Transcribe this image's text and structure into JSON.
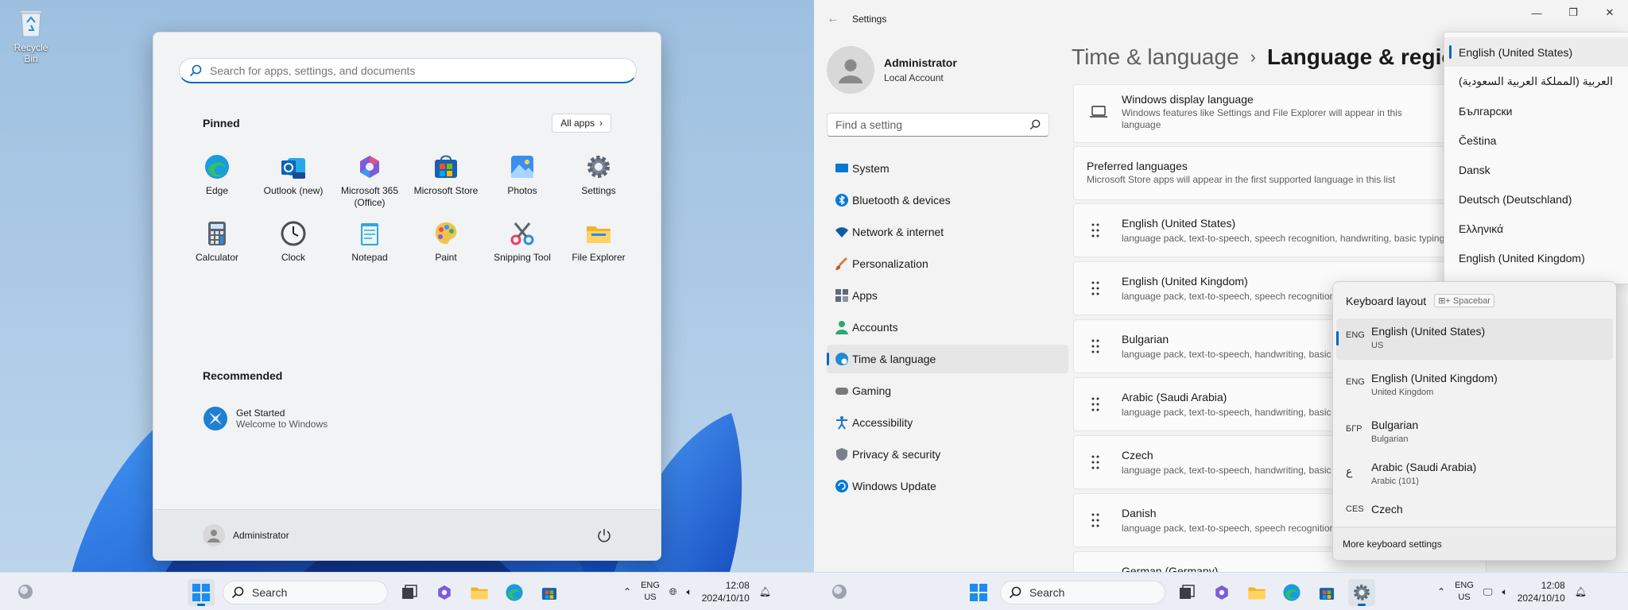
{
  "desktop": {
    "recycle_bin": "Recycle Bin"
  },
  "start": {
    "search_placeholder": "Search for apps, settings, and documents",
    "pinned_title": "Pinned",
    "all_apps": "All apps",
    "pinned": [
      {
        "label": "Edge",
        "icon": "edge-icon"
      },
      {
        "label": "Outlook (new)",
        "icon": "outlook-icon"
      },
      {
        "label": "Microsoft 365 (Office)",
        "icon": "office-icon"
      },
      {
        "label": "Microsoft Store",
        "icon": "store-icon"
      },
      {
        "label": "Photos",
        "icon": "photos-icon"
      },
      {
        "label": "Settings",
        "icon": "gear-icon"
      },
      {
        "label": "Calculator",
        "icon": "calculator-icon"
      },
      {
        "label": "Clock",
        "icon": "clock-icon"
      },
      {
        "label": "Notepad",
        "icon": "notepad-icon"
      },
      {
        "label": "Paint",
        "icon": "paint-icon"
      },
      {
        "label": "Snipping Tool",
        "icon": "snipping-icon"
      },
      {
        "label": "File Explorer",
        "icon": "folder-icon"
      }
    ],
    "recommended_title": "Recommended",
    "recommended": {
      "title": "Get Started",
      "subtitle": "Welcome to Windows"
    },
    "user": "Administrator"
  },
  "settings": {
    "title": "Settings",
    "profile": {
      "name": "Administrator",
      "account": "Local Account"
    },
    "search_placeholder": "Find a setting",
    "nav": [
      {
        "label": "System",
        "icon": "monitor-icon",
        "color": "#0078d4"
      },
      {
        "label": "Bluetooth & devices",
        "icon": "bluetooth-icon",
        "color": "#0078d4"
      },
      {
        "label": "Network & internet",
        "icon": "wifi-icon",
        "color": "#0a5ea8"
      },
      {
        "label": "Personalization",
        "icon": "brush-icon",
        "color": "#e07b39"
      },
      {
        "label": "Apps",
        "icon": "apps-icon",
        "color": "#5f6b7a"
      },
      {
        "label": "Accounts",
        "icon": "person-icon",
        "color": "#2aa876"
      },
      {
        "label": "Time & language",
        "icon": "globe-clock-icon",
        "color": "#1f8ad8"
      },
      {
        "label": "Gaming",
        "icon": "gamepad-icon",
        "color": "#7a7a7a"
      },
      {
        "label": "Accessibility",
        "icon": "accessibility-icon",
        "color": "#1d6fc9"
      },
      {
        "label": "Privacy & security",
        "icon": "shield-icon",
        "color": "#7a7f88"
      },
      {
        "label": "Windows Update",
        "icon": "update-icon",
        "color": "#0078d4"
      }
    ],
    "breadcrumb": {
      "parent": "Time & language",
      "current": "Language & regio"
    },
    "display_language": {
      "title": "Windows display language",
      "desc": "Windows features like Settings and File Explorer will appear in this language"
    },
    "preferred": {
      "title": "Preferred languages",
      "desc": "Microsoft Store apps will appear in the first supported language in this list"
    },
    "languages": [
      {
        "name": "English (United States)",
        "features": "language pack, text-to-speech, speech recognition, handwriting, basic typing"
      },
      {
        "name": "English (United Kingdom)",
        "features": "language pack, text-to-speech, speech recognition, handwriting"
      },
      {
        "name": "Bulgarian",
        "features": "language pack, text-to-speech, handwriting, basic typing"
      },
      {
        "name": "Arabic (Saudi Arabia)",
        "features": "language pack, text-to-speech, handwriting, basic typing"
      },
      {
        "name": "Czech",
        "features": "language pack, text-to-speech, handwriting, basic typing"
      },
      {
        "name": "Danish",
        "features": "language pack, text-to-speech, speech recognition"
      },
      {
        "name": "German (Germany)",
        "features": ""
      }
    ],
    "display_language_options": [
      "English (United States)",
      "العربية (المملكة العربية السعودية)",
      "Български",
      "Čeština",
      "Dansk",
      "Deutsch (Deutschland)",
      "Ελληνικά",
      "English (United Kingdom)"
    ],
    "keyboard": {
      "title": "Keyboard layout",
      "hint": "+ Spacebar",
      "items": [
        {
          "code": "ENG",
          "name": "English (United States)",
          "sub": "US"
        },
        {
          "code": "ENG",
          "name": "English (United Kingdom)",
          "sub": "United Kingdom"
        },
        {
          "code": "БГР",
          "name": "Bulgarian",
          "sub": "Bulgarian"
        },
        {
          "code": "ع",
          "name": "Arabic (Saudi Arabia)",
          "sub": "Arabic (101)"
        },
        {
          "code": "CES",
          "name": "Czech",
          "sub": ""
        }
      ],
      "more": "More keyboard settings"
    }
  },
  "taskbar": {
    "search": "Search",
    "lang": {
      "code": "ENG",
      "region": "US"
    },
    "time": "12:08",
    "date": "2024/10/10"
  },
  "colors": {
    "accent": "#0067c0"
  }
}
